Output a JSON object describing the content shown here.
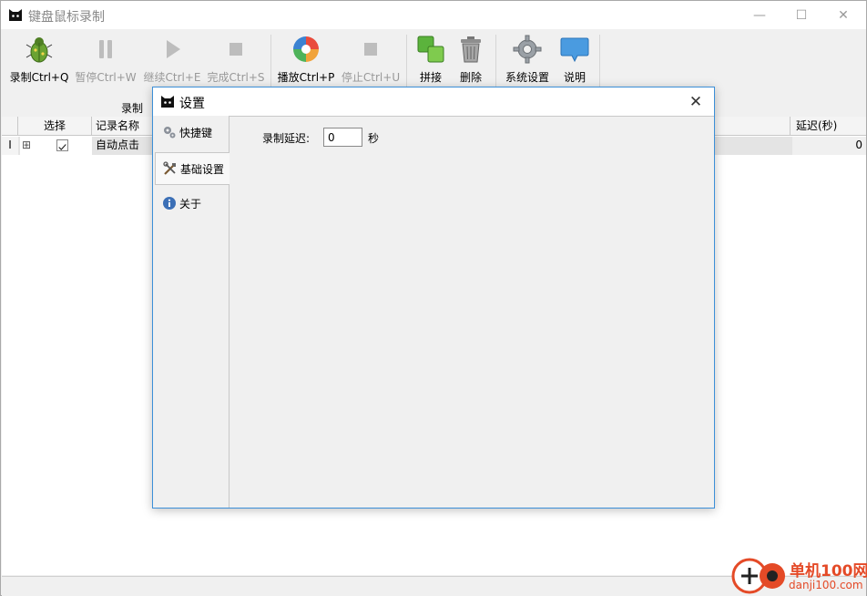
{
  "window": {
    "title": "键盘鼠标录制",
    "minimize_glyph": "—",
    "maximize_glyph": "☐",
    "close_glyph": "✕"
  },
  "toolbar": {
    "record": {
      "label": "录制Ctrl+Q",
      "icon": "bug-icon",
      "enabled": true
    },
    "pause": {
      "label": "暂停Ctrl+W",
      "icon": "pause-icon",
      "enabled": false
    },
    "resume": {
      "label": "继续Ctrl+E",
      "icon": "play-icon",
      "enabled": false
    },
    "finish": {
      "label": "完成Ctrl+S",
      "icon": "stop-icon",
      "enabled": false
    },
    "playback": {
      "label": "播放Ctrl+P",
      "icon": "color-disc-icon",
      "enabled": true
    },
    "stop": {
      "label": "停止Ctrl+U",
      "icon": "stop-icon",
      "enabled": false
    },
    "merge": {
      "label": "拼接",
      "icon": "merge-icon",
      "enabled": true
    },
    "delete": {
      "label": "删除",
      "icon": "trash-icon",
      "enabled": true
    },
    "settings": {
      "label": "系统设置",
      "icon": "gear-icon",
      "enabled": true
    },
    "help": {
      "label": "说明",
      "icon": "speech-bubble-icon",
      "enabled": true
    },
    "group_label": "录制"
  },
  "table": {
    "columns": {
      "select": "选择",
      "name": "记录名称",
      "delay": "延迟(秒)"
    },
    "rows": [
      {
        "index": "I",
        "expand": "⊞",
        "checked": true,
        "name": "自动点击",
        "delay": "0"
      }
    ]
  },
  "dialog": {
    "title": "设置",
    "close_glyph": "✕",
    "tabs": [
      {
        "label": "快捷键",
        "icon": "gears-icon",
        "active": false
      },
      {
        "label": "基础设置",
        "icon": "tools-icon",
        "active": true
      },
      {
        "label": "关于",
        "icon": "info-icon",
        "active": false
      }
    ],
    "record_delay": {
      "label": "录制延迟:",
      "value": "0",
      "unit": "秒"
    }
  },
  "watermark": {
    "text": "单机100网",
    "sub": "danji100.com"
  },
  "colors": {
    "accent": "#3c8fd8",
    "watermark": "#e44a27"
  }
}
